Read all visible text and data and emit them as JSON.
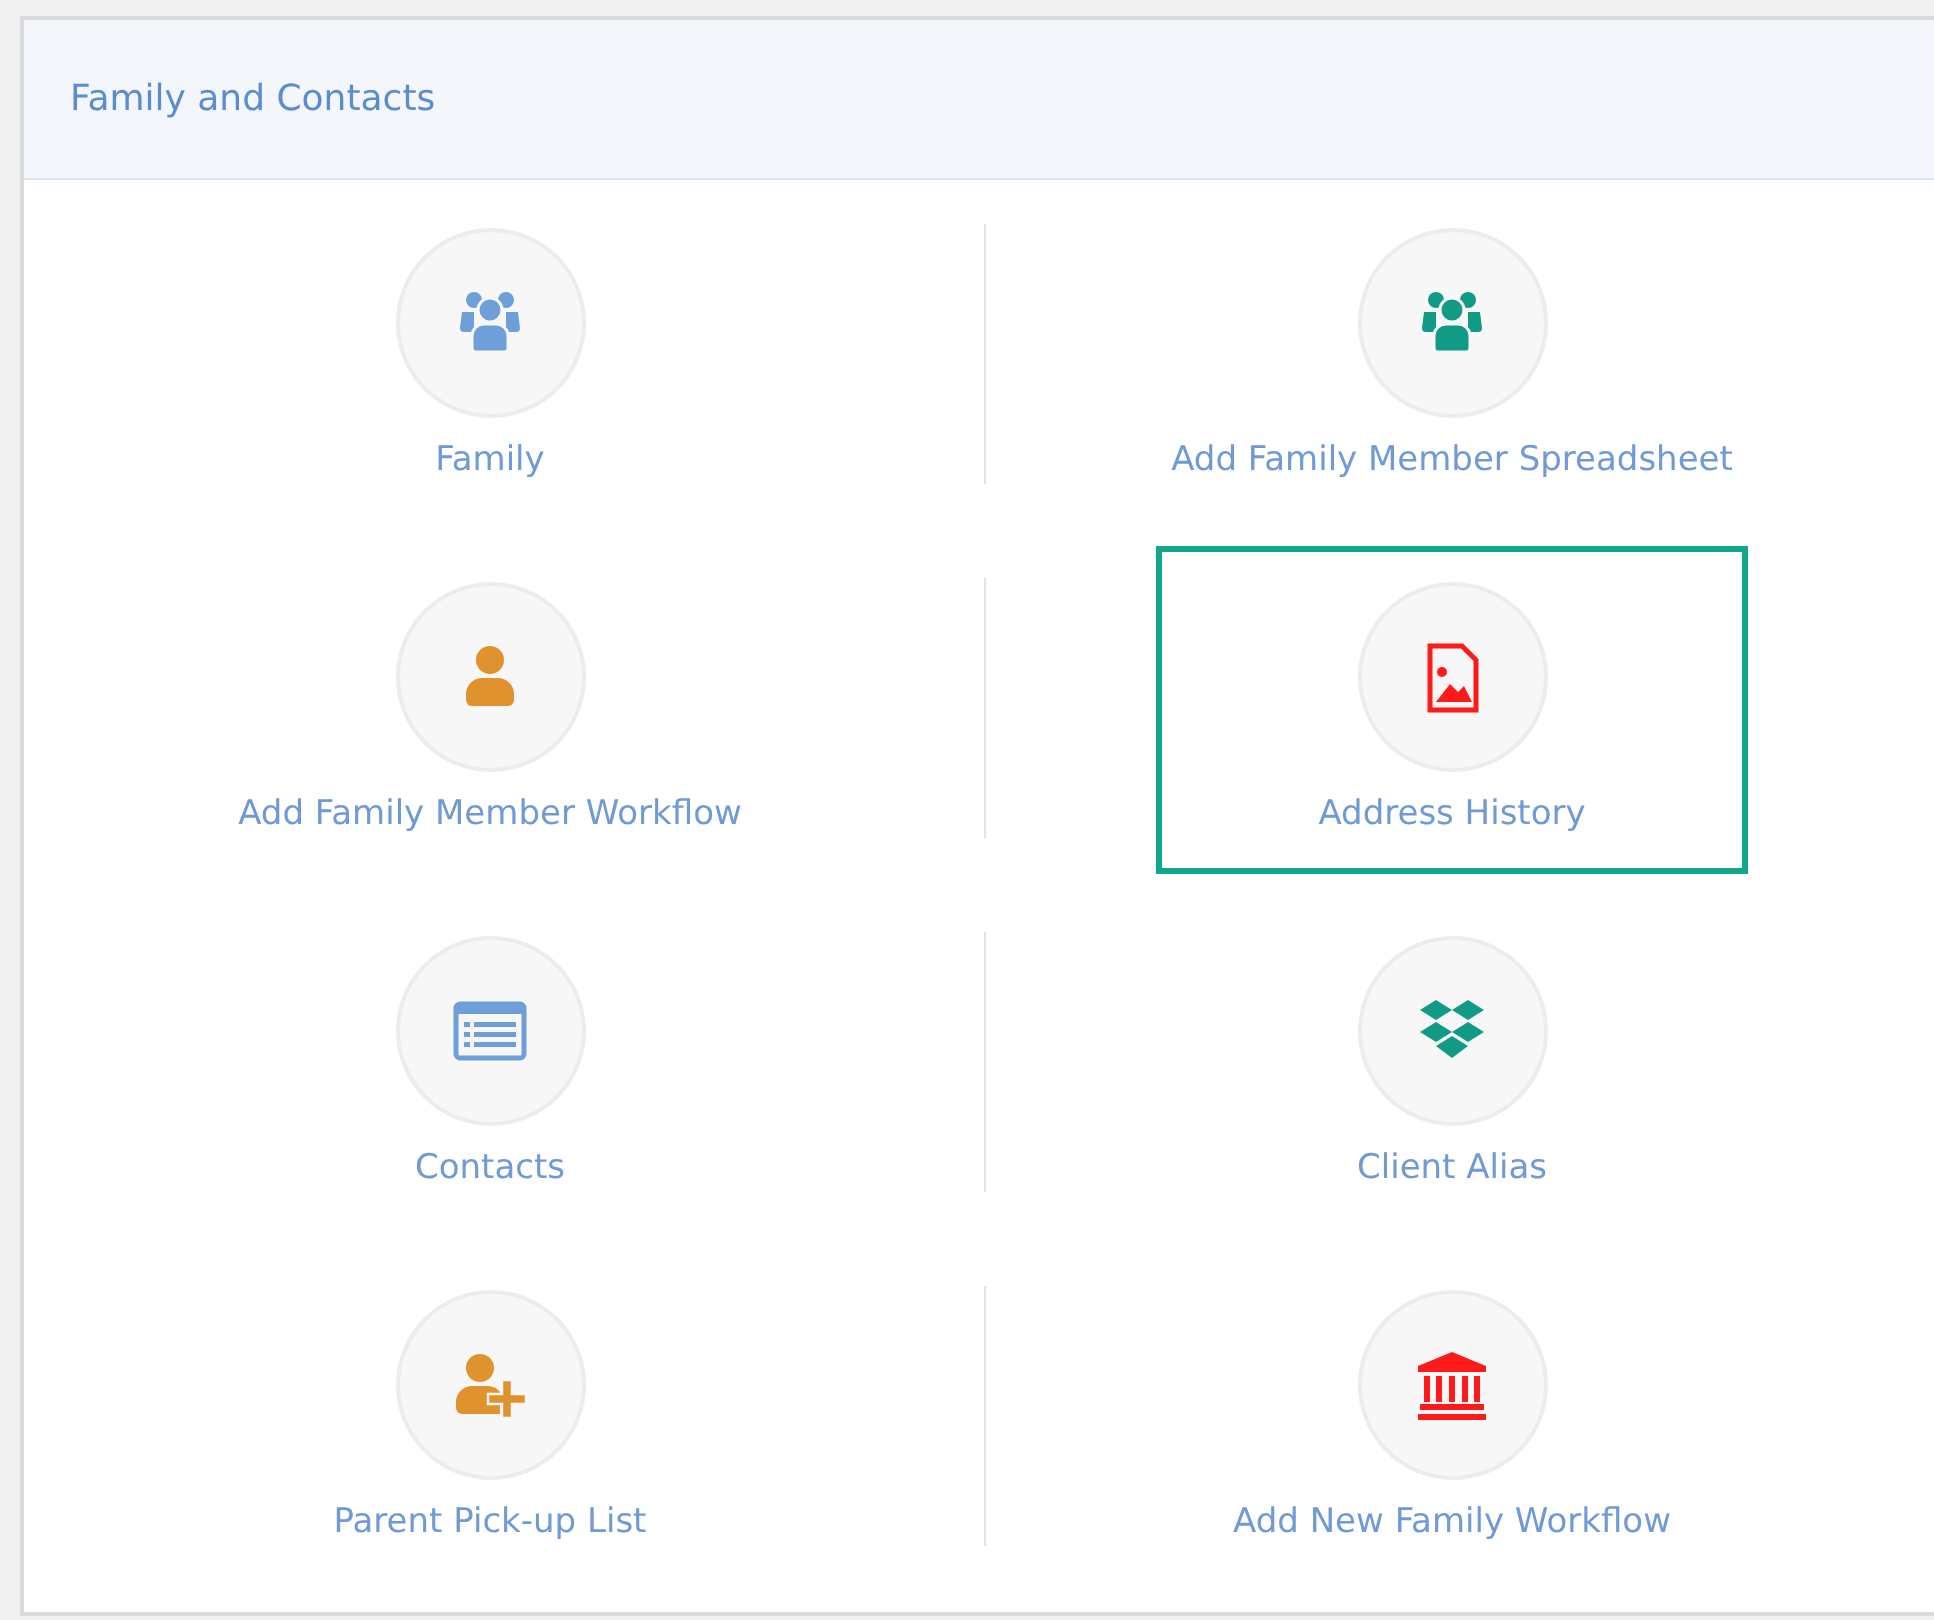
{
  "panel": {
    "title": "Family and Contacts"
  },
  "items": [
    {
      "label": "Family",
      "kind": "group",
      "color": "#6f9fd8",
      "selected": false
    },
    {
      "label": "Add Family Member Spreadsheet",
      "kind": "group",
      "color": "#119a85",
      "selected": false
    },
    {
      "label": "Add Family Member Workflow",
      "kind": "user",
      "color": "#e0922f",
      "selected": false
    },
    {
      "label": "Address History",
      "kind": "file",
      "color": "#ff1a1a",
      "selected": true
    },
    {
      "label": "Contacts",
      "kind": "window",
      "color": "#6f9fd8",
      "selected": false
    },
    {
      "label": "Client Alias",
      "kind": "boxes",
      "color": "#119a85",
      "selected": false
    },
    {
      "label": "Parent Pick-up List",
      "kind": "adduser",
      "color": "#e0922f",
      "selected": false
    },
    {
      "label": "Add New Family Workflow",
      "kind": "bank",
      "color": "#ff1a1a",
      "selected": false
    }
  ]
}
